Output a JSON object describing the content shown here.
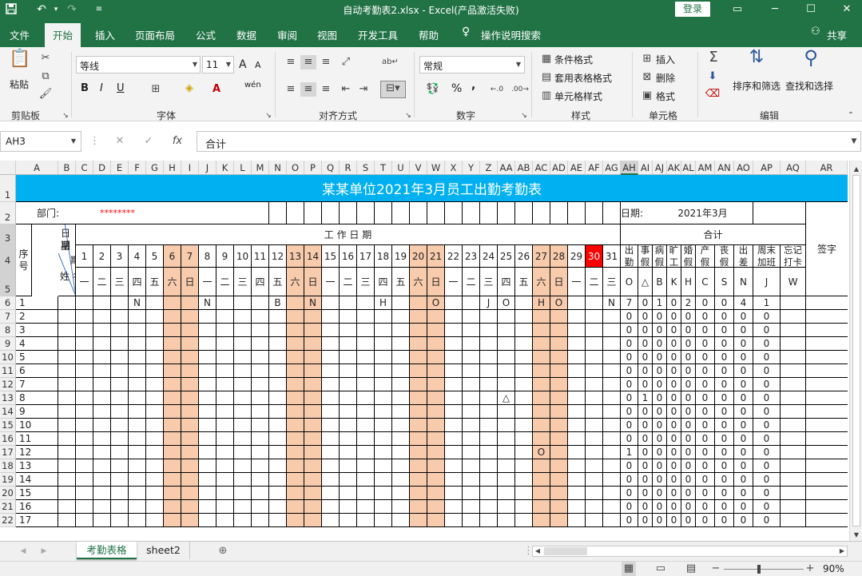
{
  "titlebar": {
    "title": "自动考勤表2.xlsx  -  Excel(产品激活失败)",
    "login_label": "登录",
    "save_icon": "save-icon",
    "undo_icon": "undo-icon",
    "redo_icon": "redo-icon"
  },
  "menu": {
    "items": [
      "文件",
      "开始",
      "插入",
      "页面布局",
      "公式",
      "数据",
      "审阅",
      "视图",
      "开发工具",
      "帮助"
    ],
    "active": "开始",
    "tell_me": "操作说明搜索",
    "share": "共享"
  },
  "ribbon": {
    "clipboard": {
      "paste": "粘贴",
      "label": "剪贴板"
    },
    "font": {
      "name": "等线",
      "size": "11",
      "grow": "A",
      "shrink": "A",
      "bold": "B",
      "italic": "I",
      "underline": "U",
      "phonetic": "wén",
      "label": "字体"
    },
    "alignment": {
      "label": "对齐方式"
    },
    "number": {
      "format": "常规",
      "percent": "%",
      "comma": ",",
      "label": "数字"
    },
    "styles": {
      "conditional": "条件格式",
      "table": "套用表格格式",
      "cell": "单元格样式",
      "label": "样式"
    },
    "cells": {
      "insert": "插入",
      "delete": "删除",
      "format": "格式",
      "label": "单元格"
    },
    "editing": {
      "sort": "排序和筛选",
      "find": "查找和选择",
      "label": "编辑"
    }
  },
  "formula_bar": {
    "name_box": "AH3",
    "formula": "合计"
  },
  "sheet": {
    "columns": [
      "A",
      "B",
      "C",
      "D",
      "E",
      "F",
      "G",
      "H",
      "I",
      "J",
      "K",
      "L",
      "M",
      "N",
      "O",
      "P",
      "Q",
      "R",
      "S",
      "T",
      "U",
      "V",
      "W",
      "X",
      "Y",
      "Z",
      "AA",
      "AB",
      "AC",
      "AD",
      "AE",
      "AF",
      "AG",
      "AH",
      "AI",
      "AJ",
      "AK",
      "AL",
      "AM",
      "AN",
      "AO",
      "AP",
      "AQ",
      "AR"
    ],
    "banner_title": "某某单位2021年3月员工出勤考勤表",
    "dept_label": "部门:",
    "dept_value": "********",
    "date_label": "日期:",
    "date_value": "2021年3月",
    "work_days_label": "工 作 日 期",
    "total_label": "合计",
    "sign_label": "签字",
    "seq_label": "序号",
    "header_date": "日期",
    "header_week1": "星",
    "header_week2": "期",
    "header_name": "姓 名",
    "days": [
      "1",
      "2",
      "3",
      "4",
      "5",
      "6",
      "7",
      "8",
      "9",
      "10",
      "11",
      "12",
      "13",
      "14",
      "15",
      "16",
      "17",
      "18",
      "19",
      "20",
      "21",
      "22",
      "23",
      "24",
      "25",
      "26",
      "27",
      "28",
      "29",
      "30",
      "31"
    ],
    "weekdays": [
      "一",
      "二",
      "三",
      "四",
      "五",
      "六",
      "日",
      "一",
      "二",
      "三",
      "四",
      "五",
      "六",
      "日",
      "一",
      "二",
      "三",
      "四",
      "五",
      "六",
      "日",
      "一",
      "二",
      "三",
      "四",
      "五",
      "六",
      "日",
      "一",
      "二",
      "三"
    ],
    "weekend_days": [
      6,
      7,
      13,
      14,
      20,
      21,
      27,
      28
    ],
    "highlight_day": 30,
    "summary_headers": [
      "出勤",
      "事假",
      "病假",
      "旷工",
      "婚假",
      "产假",
      "丧假",
      "出差",
      "周末加班",
      "忘记打卡"
    ],
    "summary_codes": [
      "O",
      "△",
      "B",
      "K",
      "H",
      "C",
      "S",
      "N",
      "J",
      "W"
    ],
    "rows": [
      {
        "seq": "1",
        "marks": {
          "4": "N",
          "8": "N",
          "12": "B",
          "14": "N",
          "18": "H",
          "21": "O",
          "24": "J",
          "25": "O",
          "27": "H",
          "28": "O",
          "31": "N"
        },
        "totals": [
          "7",
          "0",
          "1",
          "0",
          "2",
          "0",
          "0",
          "4",
          "1",
          ""
        ]
      },
      {
        "seq": "2",
        "marks": {},
        "totals": [
          "0",
          "0",
          "0",
          "0",
          "0",
          "0",
          "0",
          "0",
          "0",
          ""
        ]
      },
      {
        "seq": "3",
        "marks": {},
        "totals": [
          "0",
          "0",
          "0",
          "0",
          "0",
          "0",
          "0",
          "0",
          "0",
          ""
        ]
      },
      {
        "seq": "4",
        "marks": {},
        "totals": [
          "0",
          "0",
          "0",
          "0",
          "0",
          "0",
          "0",
          "0",
          "0",
          ""
        ]
      },
      {
        "seq": "5",
        "marks": {},
        "totals": [
          "0",
          "0",
          "0",
          "0",
          "0",
          "0",
          "0",
          "0",
          "0",
          ""
        ]
      },
      {
        "seq": "6",
        "marks": {},
        "totals": [
          "0",
          "0",
          "0",
          "0",
          "0",
          "0",
          "0",
          "0",
          "0",
          ""
        ]
      },
      {
        "seq": "7",
        "marks": {},
        "totals": [
          "0",
          "0",
          "0",
          "0",
          "0",
          "0",
          "0",
          "0",
          "0",
          ""
        ]
      },
      {
        "seq": "8",
        "marks": {
          "25": "△"
        },
        "totals": [
          "0",
          "1",
          "0",
          "0",
          "0",
          "0",
          "0",
          "0",
          "0",
          ""
        ]
      },
      {
        "seq": "9",
        "marks": {},
        "totals": [
          "0",
          "0",
          "0",
          "0",
          "0",
          "0",
          "0",
          "0",
          "0",
          ""
        ]
      },
      {
        "seq": "10",
        "marks": {},
        "totals": [
          "0",
          "0",
          "0",
          "0",
          "0",
          "0",
          "0",
          "0",
          "0",
          ""
        ]
      },
      {
        "seq": "11",
        "marks": {},
        "totals": [
          "0",
          "0",
          "0",
          "0",
          "0",
          "0",
          "0",
          "0",
          "0",
          ""
        ]
      },
      {
        "seq": "12",
        "marks": {
          "27": "O"
        },
        "totals": [
          "1",
          "0",
          "0",
          "0",
          "0",
          "0",
          "0",
          "0",
          "0",
          ""
        ]
      },
      {
        "seq": "13",
        "marks": {},
        "totals": [
          "0",
          "0",
          "0",
          "0",
          "0",
          "0",
          "0",
          "0",
          "0",
          ""
        ]
      },
      {
        "seq": "14",
        "marks": {},
        "totals": [
          "0",
          "0",
          "0",
          "0",
          "0",
          "0",
          "0",
          "0",
          "0",
          ""
        ]
      },
      {
        "seq": "15",
        "marks": {},
        "totals": [
          "0",
          "0",
          "0",
          "0",
          "0",
          "0",
          "0",
          "0",
          "0",
          ""
        ]
      },
      {
        "seq": "16",
        "marks": {},
        "totals": [
          "0",
          "0",
          "0",
          "0",
          "0",
          "0",
          "0",
          "0",
          "0",
          ""
        ]
      },
      {
        "seq": "17",
        "marks": {},
        "totals": [
          "0",
          "0",
          "0",
          "0",
          "0",
          "0",
          "0",
          "0",
          "0",
          ""
        ]
      }
    ],
    "row_numbers": [
      "1",
      "2",
      "3",
      "4",
      "5",
      "6",
      "7",
      "8",
      "9",
      "10",
      "11",
      "12",
      "13",
      "14",
      "15",
      "16",
      "17",
      "18",
      "19",
      "20",
      "21",
      "22"
    ]
  },
  "tabs": {
    "items": [
      "考勤表格",
      "sheet2"
    ],
    "active": "考勤表格"
  },
  "status": {
    "zoom": "90%"
  },
  "colors": {
    "excel_green": "#217346",
    "banner": "#00b0f0",
    "weekend": "#f8cbad",
    "highlight": "#ff0000",
    "dept_value": "#ff0000"
  }
}
